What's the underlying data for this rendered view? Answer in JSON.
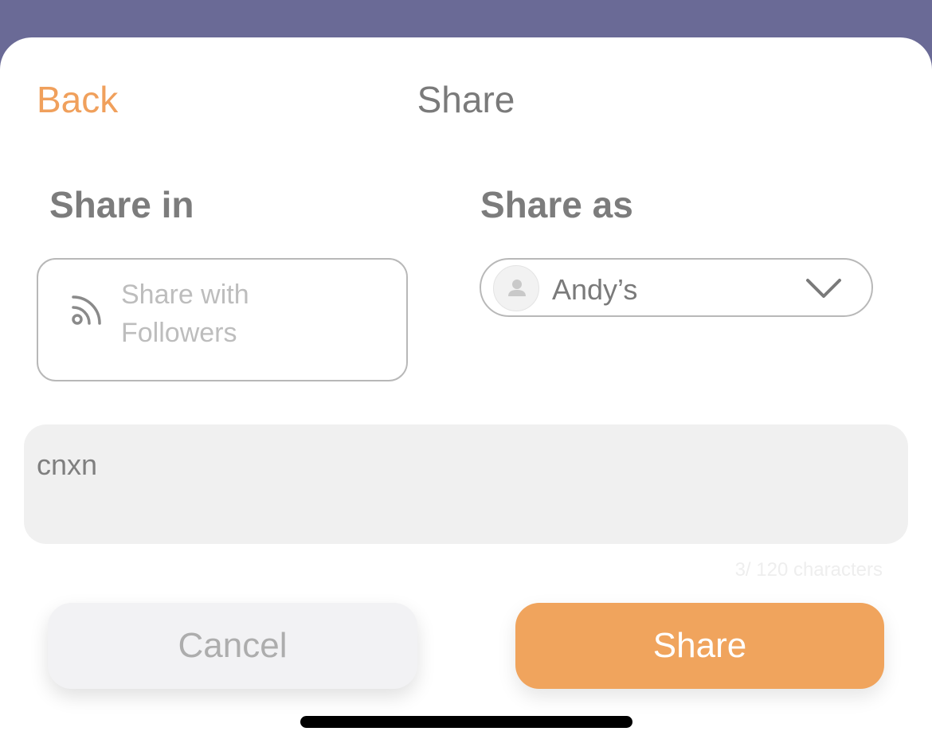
{
  "header": {
    "back_label": "Back",
    "title": "Share"
  },
  "share_in": {
    "label": "Share in",
    "option_line1": "Share with",
    "option_line2": "Followers",
    "icon": "rss-icon"
  },
  "share_as": {
    "label": "Share as",
    "selected": "Andy’s",
    "icon": "avatar-placeholder-icon"
  },
  "message": {
    "value": "cnxn",
    "char_count": "3/ 120 characters"
  },
  "actions": {
    "cancel_label": "Cancel",
    "share_label": "Share"
  },
  "colors": {
    "accent": "#f0a45d",
    "backdrop": "#6a6a96"
  }
}
